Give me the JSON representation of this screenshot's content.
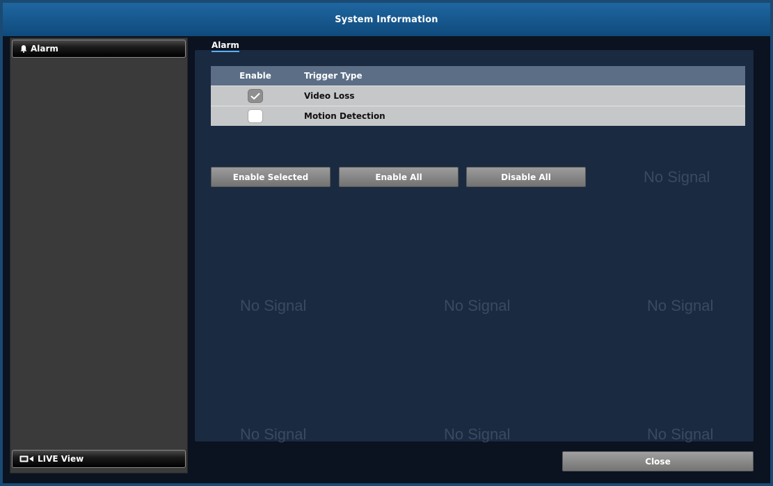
{
  "window": {
    "title": "System Information"
  },
  "background": {
    "cell_label": "No Signal"
  },
  "sidebar": {
    "top_item": {
      "label": "Alarm",
      "icon": "bell-icon"
    },
    "bottom_item": {
      "label": "LIVE View",
      "icon": "live-view-icon"
    }
  },
  "tabs": {
    "active": "Alarm"
  },
  "table": {
    "headers": {
      "enable": "Enable",
      "trigger_type": "Trigger Type"
    },
    "rows": [
      {
        "enabled": true,
        "trigger_type": "Video Loss"
      },
      {
        "enabled": false,
        "trigger_type": "Motion Detection"
      }
    ]
  },
  "buttons": {
    "enable_selected": "Enable Selected",
    "enable_all": "Enable All",
    "disable_all": "Disable All",
    "close": "Close"
  },
  "colors": {
    "titlebar": "#1f66a0",
    "tab_underline": "#59b0ff",
    "table_header": "#5b6e86",
    "table_row": "#c6c7c8"
  }
}
